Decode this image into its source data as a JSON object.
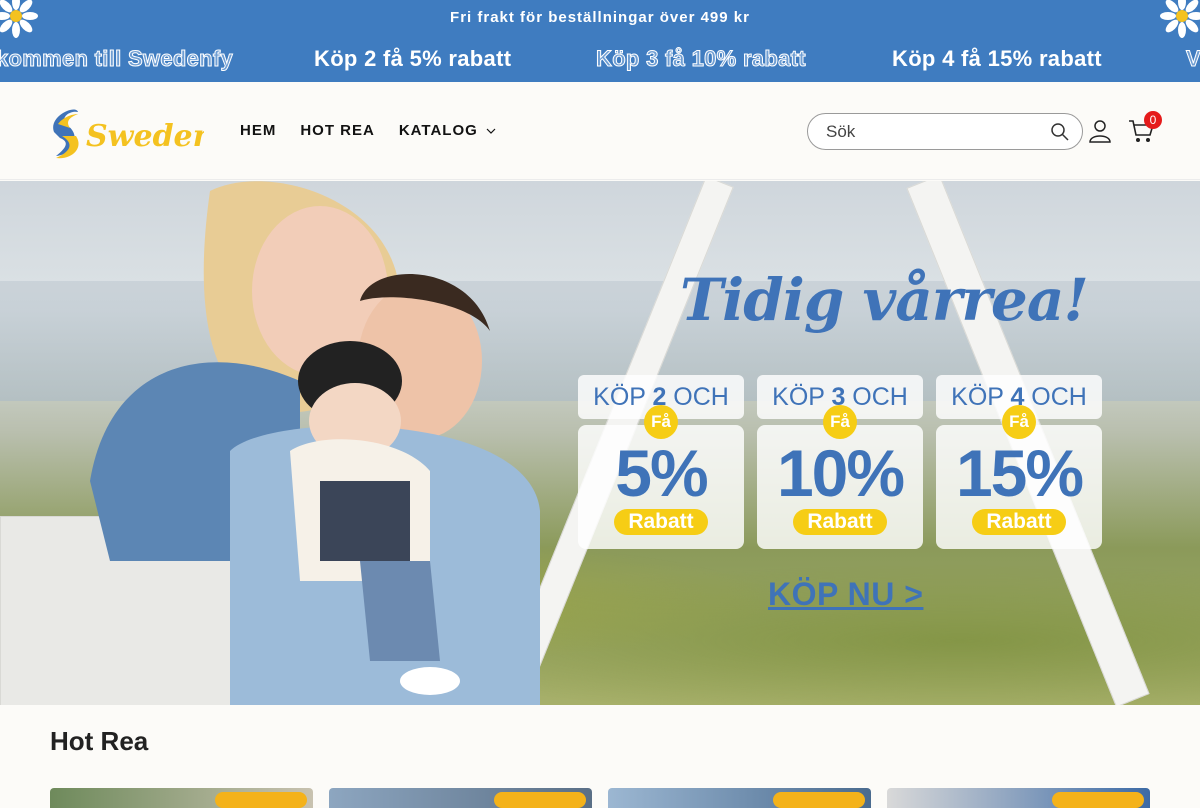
{
  "announcement": {
    "top_text": "Fri frakt för beställningar över 499 kr",
    "marquee": [
      "kommen till Swedenfy",
      "Köp 2 få 5% rabatt",
      "Köp 3 få 10% rabatt",
      "Köp 4 få 15% rabatt",
      "V"
    ]
  },
  "header": {
    "logo_text": "Swedenfy",
    "nav": [
      {
        "label": "HEM"
      },
      {
        "label": "HOT REA"
      },
      {
        "label": "KATALOG"
      }
    ],
    "search_placeholder": "Sök",
    "cart_count": "0"
  },
  "hero": {
    "title": "Tidig vårrea!",
    "offers": [
      {
        "top_a": "KÖP ",
        "top_num": "2",
        "top_b": " OCH",
        "fa": "Få",
        "pct": "5%",
        "rabatt": "Rabatt"
      },
      {
        "top_a": "KÖP ",
        "top_num": "3",
        "top_b": " OCH",
        "fa": "Få",
        "pct": "10%",
        "rabatt": "Rabatt"
      },
      {
        "top_a": "KÖP ",
        "top_num": "4",
        "top_b": " OCH",
        "fa": "Få",
        "pct": "15%",
        "rabatt": "Rabatt"
      }
    ],
    "cta": "KÖP NU >"
  },
  "section": {
    "title": "Hot Rea"
  },
  "colors": {
    "brand_blue": "#3f7cc0",
    "accent_yellow": "#f6cd15",
    "cart_badge": "#e51b1b"
  }
}
